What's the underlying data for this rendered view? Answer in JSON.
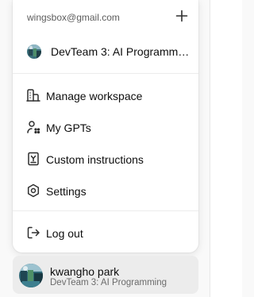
{
  "account": {
    "email": "wingsbox@gmail.com",
    "add_icon": "plus-icon"
  },
  "workspace": {
    "name": "DevTeam 3: AI Programming",
    "avatar": "workspace-avatar-image"
  },
  "menu": {
    "items": [
      {
        "label": "Manage workspace",
        "icon": "building-icon"
      },
      {
        "label": "My GPTs",
        "icon": "gpts-icon"
      },
      {
        "label": "Custom instructions",
        "icon": "instructions-icon"
      },
      {
        "label": "Settings",
        "icon": "gear-icon"
      },
      {
        "label": "Log out",
        "icon": "logout-icon"
      }
    ]
  },
  "profile": {
    "name": "kwangho park",
    "workspace": "DevTeam 3: AI Programming",
    "avatar": "user-avatar-image"
  },
  "colors": {
    "menu_bg": "#ffffff",
    "page_bg": "#f9f9f9",
    "profile_bg": "#ececec",
    "text": "#0d0d0d",
    "muted": "#5d5d5d"
  }
}
